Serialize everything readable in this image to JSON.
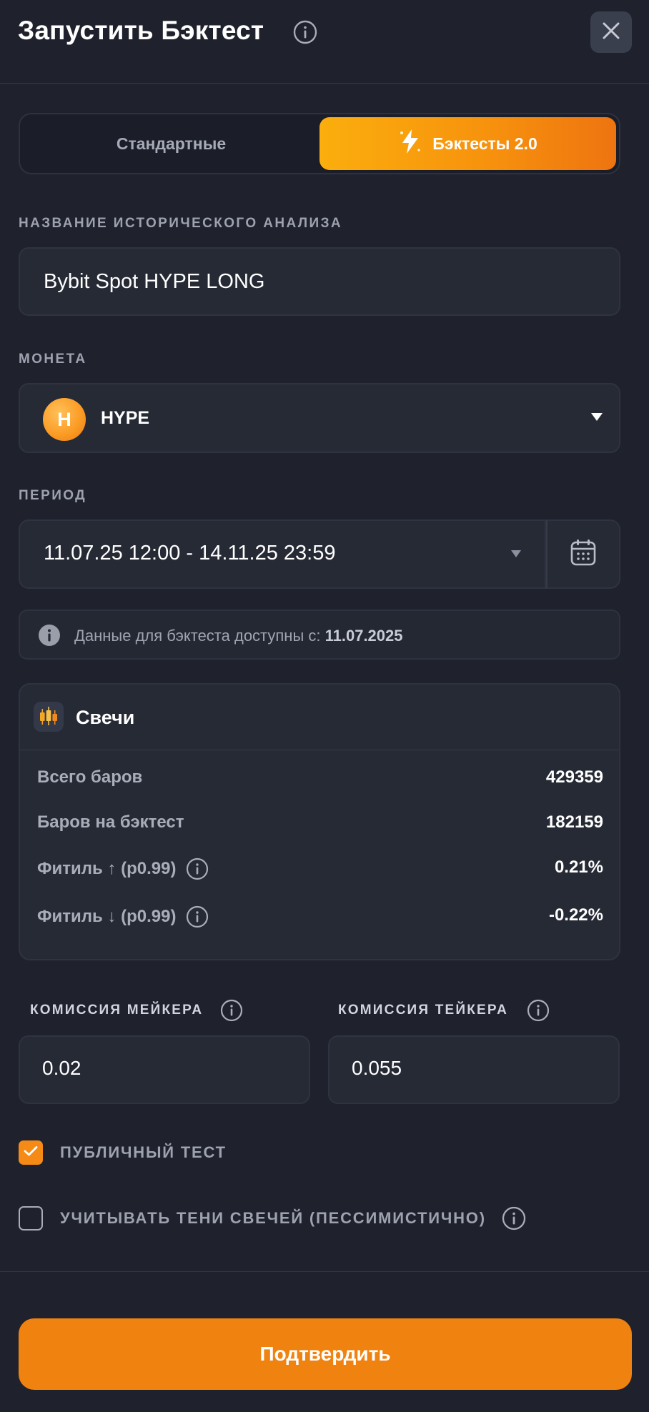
{
  "header": {
    "title": "Запустить Бэктест"
  },
  "tabs": [
    {
      "label": "Стандартные",
      "active": false
    },
    {
      "label": "Бэктесты 2.0",
      "active": true
    }
  ],
  "fields": {
    "name_label": "НАЗВАНИЕ ИСТОРИЧЕСКОГО АНАЛИЗА",
    "name_value": "Bybit Spot HYPE LONG",
    "coin_label": "МОНЕТА",
    "coin_symbol_letter": "H",
    "coin_name": "HYPE",
    "period_label": "ПЕРИОД",
    "period_value": "11.07.25 12:00 - 14.11.25 23:59"
  },
  "notice": {
    "text": "Данные для бэктеста доступны с:",
    "date": "11.07.2025"
  },
  "candles": {
    "title": "Свечи",
    "stats": [
      {
        "label": "Всего баров",
        "value": "429359"
      },
      {
        "label": "Баров на бэктест",
        "value": "182159"
      },
      {
        "label": "Фитиль ↑ (p0.99)",
        "value": "0.21%"
      },
      {
        "label": "Фитиль ↓ (p0.99)",
        "value": "-0.22%"
      }
    ]
  },
  "commission": {
    "maker_label": "КОМИССИЯ МЕЙКЕРА",
    "maker_value": "0.02",
    "taker_label": "КОМИССИЯ ТЕЙКЕРА",
    "taker_value": "0.055"
  },
  "options": {
    "public_label": "ПУБЛИЧНЫЙ ТЕСТ",
    "public_checked": true,
    "shadows_label": "УЧИТЫВАТЬ ТЕНИ СВЕЧЕЙ (ПЕССИМИСТИЧНО)",
    "shadows_checked": false
  },
  "confirm_label": "Подтвердить",
  "colors": {
    "background": "#1f222d",
    "accent": "#f0820f",
    "panel": "#262a35"
  }
}
